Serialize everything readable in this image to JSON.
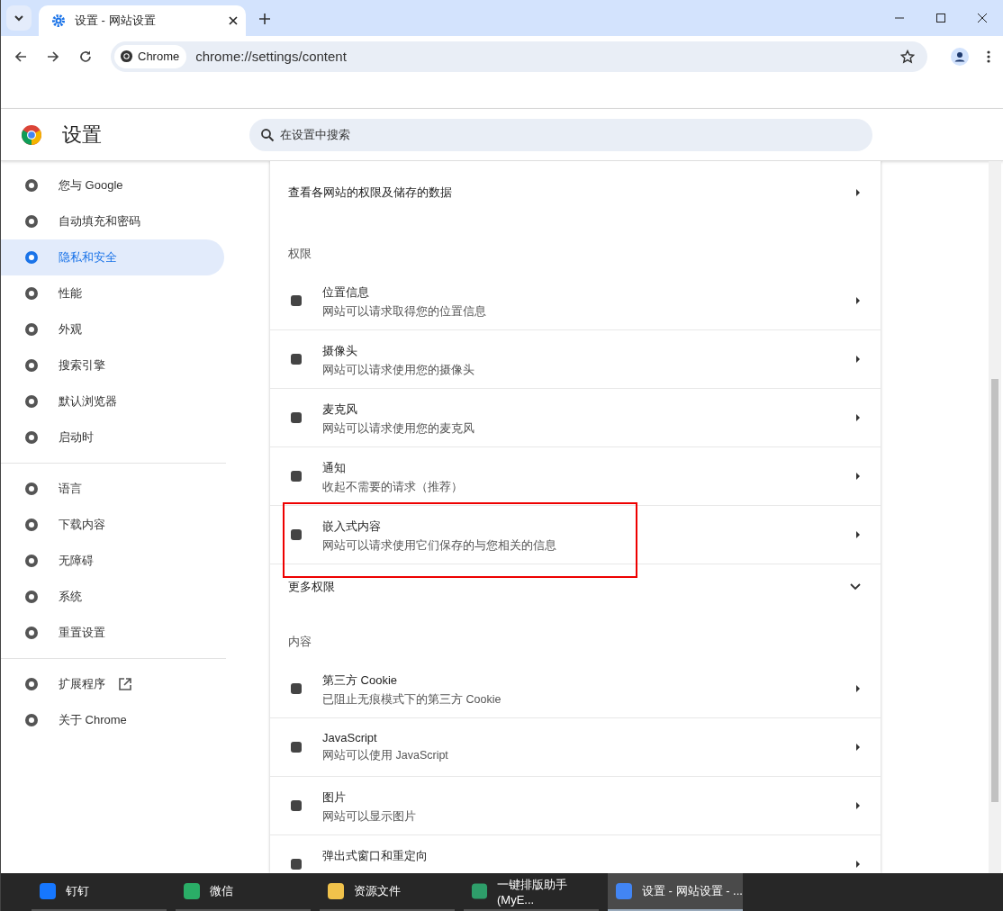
{
  "tab_strip": {
    "tabs": [
      {
        "title": "设置 - 网站设置",
        "selected": true
      }
    ]
  },
  "toolbar": {
    "site_chip": "Chrome",
    "url": "chrome://settings/content"
  },
  "settings_header": {
    "title": "设置",
    "search": {
      "placeholder": "在设置中搜索"
    }
  },
  "sidebar": {
    "groups": [
      [
        {
          "label": "您与 Google",
          "selected": false,
          "external": false
        },
        {
          "label": "自动填充和密码",
          "selected": false,
          "external": false
        },
        {
          "label": "隐私和安全",
          "selected": true,
          "external": false
        },
        {
          "label": "性能",
          "selected": false,
          "external": false
        },
        {
          "label": "外观",
          "selected": false,
          "external": false
        },
        {
          "label": "搜索引擎",
          "selected": false,
          "external": false
        },
        {
          "label": "默认浏览器",
          "selected": false,
          "external": false
        },
        {
          "label": "启动时",
          "selected": false,
          "external": false
        }
      ],
      [
        {
          "label": "语言",
          "selected": false,
          "external": false
        },
        {
          "label": "下载内容",
          "selected": false,
          "external": false
        },
        {
          "label": "无障碍",
          "selected": false,
          "external": false
        },
        {
          "label": "系统",
          "selected": false,
          "external": false
        },
        {
          "label": "重置设置",
          "selected": false,
          "external": false
        }
      ],
      [
        {
          "label": "扩展程序",
          "selected": false,
          "external": true
        },
        {
          "label": "关于 Chrome",
          "selected": false,
          "external": false
        }
      ]
    ]
  },
  "content": {
    "top_row": {
      "title": "查看各网站的权限及储存的数据"
    },
    "sections": [
      {
        "heading": "权限",
        "rows": [
          {
            "title": "位置信息",
            "subtitle": "网站可以请求取得您的位置信息"
          },
          {
            "title": "摄像头",
            "subtitle": "网站可以请求使用您的摄像头"
          },
          {
            "title": "麦克风",
            "subtitle": "网站可以请求使用您的麦克风"
          },
          {
            "title": "通知",
            "subtitle": "收起不需要的请求（推荐）"
          },
          {
            "title": "嵌入式内容",
            "subtitle": "网站可以请求使用它们保存的与您相关的信息"
          }
        ],
        "more": {
          "label": "更多权限",
          "expanded": false
        }
      },
      {
        "heading": "内容",
        "rows": [
          {
            "title": "第三方 Cookie",
            "subtitle": "已阻止无痕模式下的第三方 Cookie"
          },
          {
            "title": "JavaScript",
            "subtitle": "网站可以使用 JavaScript"
          },
          {
            "title": "图片",
            "subtitle": "网站可以显示图片"
          },
          {
            "title": "弹出式窗口和重定向"
          }
        ]
      }
    ]
  },
  "taskbar": {
    "items": [
      {
        "label": "钉钉",
        "selected": false
      },
      {
        "label": "微信",
        "selected": false
      },
      {
        "label": "资源文件",
        "selected": false
      },
      {
        "label": "一键排版助手(MyE...",
        "selected": false
      },
      {
        "label": "设置 - 网站设置 - ...",
        "selected": true
      }
    ]
  }
}
